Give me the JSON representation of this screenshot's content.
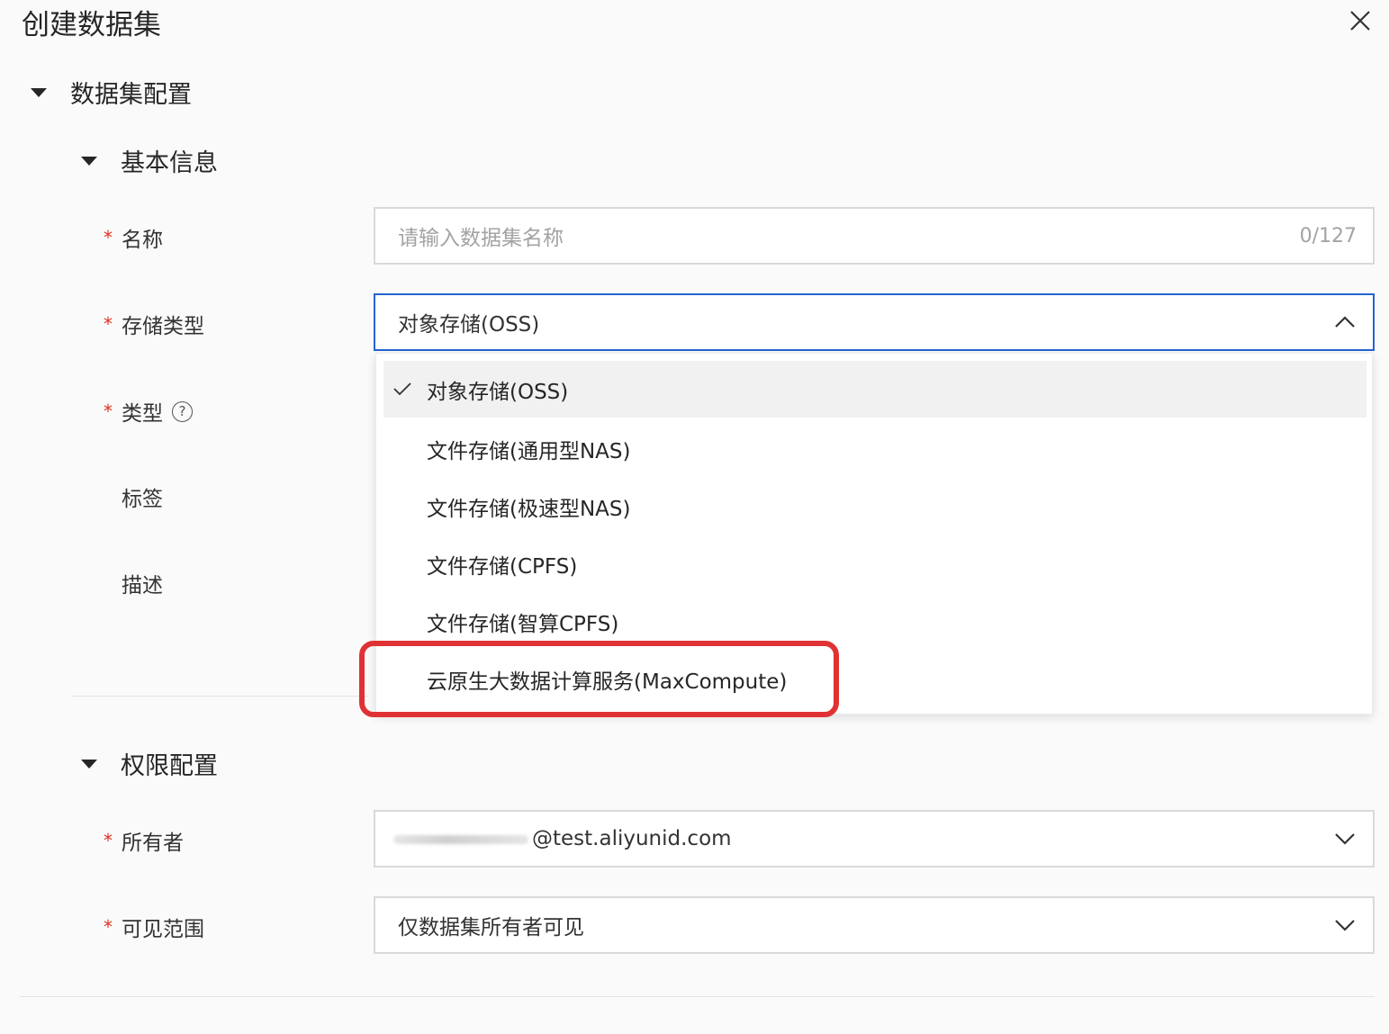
{
  "dialog": {
    "title": "创建数据集"
  },
  "sections": {
    "dataset_config": "数据集配置",
    "basic_info": "基本信息",
    "permission": "权限配置"
  },
  "fields": {
    "name": {
      "label": "名称",
      "placeholder": "请输入数据集名称",
      "counter": "0/127"
    },
    "storage_type": {
      "label": "存储类型",
      "value": "对象存储(OSS)"
    },
    "type": {
      "label": "类型"
    },
    "tags": {
      "label": "标签"
    },
    "description": {
      "label": "描述"
    },
    "owner": {
      "label": "所有者",
      "value": "@test.aliyunid.com"
    },
    "visibility": {
      "label": "可见范围",
      "value": "仅数据集所有者可见"
    }
  },
  "required_mark": "*",
  "storage_options": [
    {
      "label": "对象存储(OSS)",
      "selected": true
    },
    {
      "label": "文件存储(通用型NAS)",
      "selected": false
    },
    {
      "label": "文件存储(极速型NAS)",
      "selected": false
    },
    {
      "label": "文件存储(CPFS)",
      "selected": false
    },
    {
      "label": "文件存储(智算CPFS)",
      "selected": false
    },
    {
      "label": "云原生大数据计算服务(MaxCompute)",
      "selected": false
    }
  ],
  "icons": {
    "close": "close-icon",
    "collapse": "caret-down-icon",
    "help": "question-circle-icon",
    "select_open": "chevron-up-icon",
    "select_closed": "chevron-down-icon",
    "selected": "check-icon"
  },
  "colors": {
    "focus_border": "#2463d1",
    "required": "#e0301e",
    "highlight": "#e03234"
  }
}
